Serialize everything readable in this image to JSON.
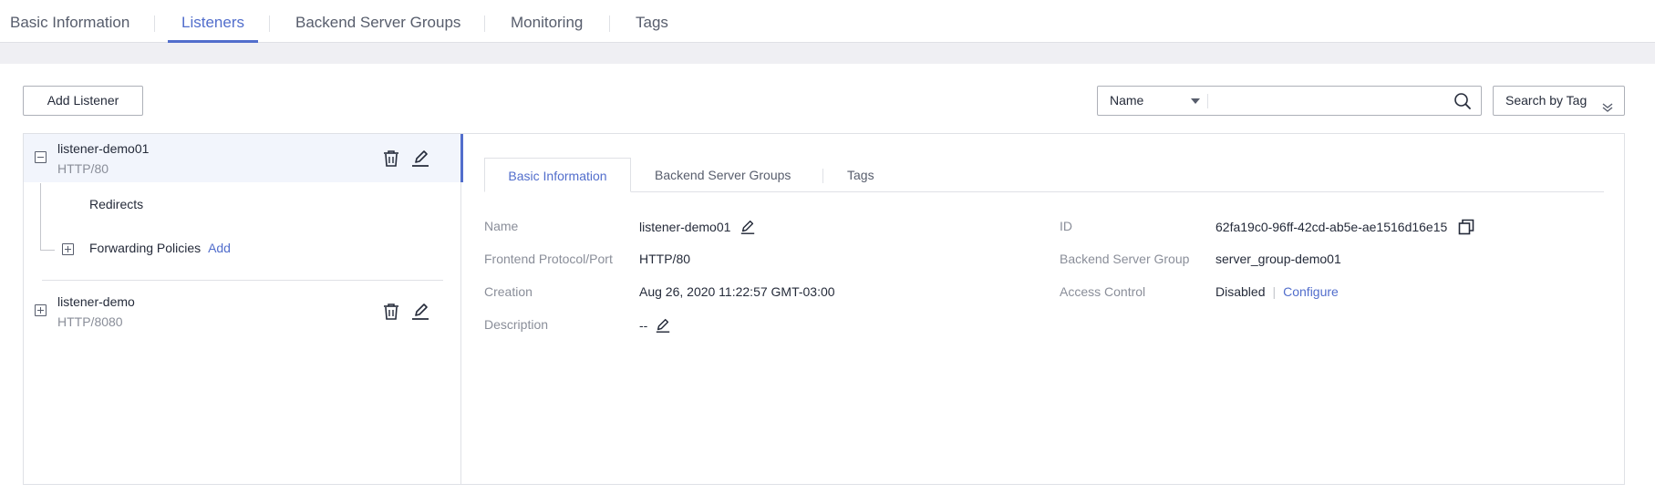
{
  "top_tabs": {
    "basic_information": "Basic Information",
    "listeners": "Listeners",
    "backend_server_groups": "Backend Server Groups",
    "monitoring": "Monitoring",
    "tags": "Tags",
    "active": "Listeners"
  },
  "toolbar": {
    "add_listener_label": "Add Listener",
    "search_field_selected": "Name",
    "search_placeholder": "",
    "search_by_tag_label": "Search by Tag"
  },
  "listeners": [
    {
      "name": "listener-demo01",
      "protocol_port": "HTTP/80",
      "expanded": true,
      "children": {
        "redirects": "Redirects",
        "forwarding_policies": "Forwarding Policies",
        "add_link": "Add"
      }
    },
    {
      "name": "listener-demo",
      "protocol_port": "HTTP/8080",
      "expanded": false
    }
  ],
  "detail_tabs": {
    "basic_information": "Basic Information",
    "backend_server_groups": "Backend Server Groups",
    "tags": "Tags",
    "active": "Basic Information"
  },
  "details": {
    "name_label": "Name",
    "name_value": "listener-demo01",
    "protocol_label": "Frontend Protocol/Port",
    "protocol_value": "HTTP/80",
    "creation_label": "Creation",
    "creation_value": "Aug 26, 2020 11:22:57 GMT-03:00",
    "description_label": "Description",
    "description_value": "--",
    "id_label": "ID",
    "id_value": "62fa19c0-96ff-42cd-ab5e-ae1516d16e15",
    "backend_group_label": "Backend Server Group",
    "backend_group_value": "server_group-demo01",
    "access_control_label": "Access Control",
    "access_control_value": "Disabled",
    "access_control_separator": "|",
    "configure_link": "Configure"
  },
  "colors": {
    "accent": "#526ecc",
    "text": "#252b3a",
    "muted": "#8a8e99",
    "border": "#dfe1e6",
    "background": "#efeff3"
  },
  "icons": [
    "delete-icon",
    "edit-icon",
    "search-icon",
    "copy-icon",
    "chevron-down-icon",
    "collapse-icon",
    "expand-icon"
  ]
}
